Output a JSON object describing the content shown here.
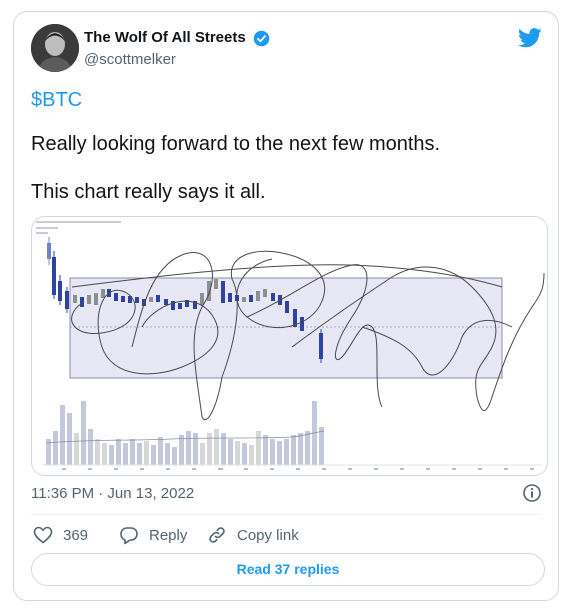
{
  "tweet": {
    "display_name": "The Wolf Of All Streets",
    "handle": "@scottmelker",
    "cashtag": "$BTC",
    "line1": "Really looking forward to the next few months.",
    "line2": "This chart really says it all.",
    "timestamp": "11:36 PM · Jun 13, 2022",
    "likes": "369",
    "reply_label": "Reply",
    "copy_label": "Copy link",
    "read_replies": "Read 37 replies"
  },
  "icons": [
    "verified-badge-icon",
    "twitter-bird-icon",
    "info-icon",
    "heart-icon",
    "reply-icon",
    "link-icon"
  ],
  "colors": {
    "brand_blue": "#1d9bf0",
    "text": "#0f1419",
    "muted": "#536471",
    "border": "#cfd9de",
    "range_band": "#e6e6f5",
    "candle_blue": "#4a5da8"
  }
}
